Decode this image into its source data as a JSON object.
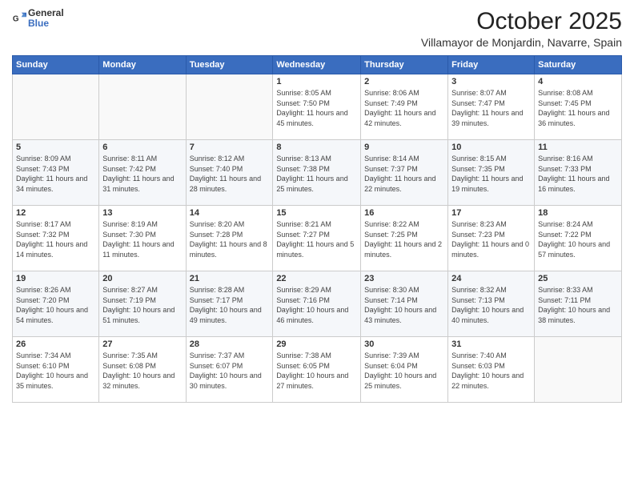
{
  "logo": {
    "general": "General",
    "blue": "Blue"
  },
  "header": {
    "month": "October 2025",
    "location": "Villamayor de Monjardin, Navarre, Spain"
  },
  "weekdays": [
    "Sunday",
    "Monday",
    "Tuesday",
    "Wednesday",
    "Thursday",
    "Friday",
    "Saturday"
  ],
  "weeks": [
    [
      {
        "day": "",
        "sunrise": "",
        "sunset": "",
        "daylight": ""
      },
      {
        "day": "",
        "sunrise": "",
        "sunset": "",
        "daylight": ""
      },
      {
        "day": "",
        "sunrise": "",
        "sunset": "",
        "daylight": ""
      },
      {
        "day": "1",
        "sunrise": "Sunrise: 8:05 AM",
        "sunset": "Sunset: 7:50 PM",
        "daylight": "Daylight: 11 hours and 45 minutes."
      },
      {
        "day": "2",
        "sunrise": "Sunrise: 8:06 AM",
        "sunset": "Sunset: 7:49 PM",
        "daylight": "Daylight: 11 hours and 42 minutes."
      },
      {
        "day": "3",
        "sunrise": "Sunrise: 8:07 AM",
        "sunset": "Sunset: 7:47 PM",
        "daylight": "Daylight: 11 hours and 39 minutes."
      },
      {
        "day": "4",
        "sunrise": "Sunrise: 8:08 AM",
        "sunset": "Sunset: 7:45 PM",
        "daylight": "Daylight: 11 hours and 36 minutes."
      }
    ],
    [
      {
        "day": "5",
        "sunrise": "Sunrise: 8:09 AM",
        "sunset": "Sunset: 7:43 PM",
        "daylight": "Daylight: 11 hours and 34 minutes."
      },
      {
        "day": "6",
        "sunrise": "Sunrise: 8:11 AM",
        "sunset": "Sunset: 7:42 PM",
        "daylight": "Daylight: 11 hours and 31 minutes."
      },
      {
        "day": "7",
        "sunrise": "Sunrise: 8:12 AM",
        "sunset": "Sunset: 7:40 PM",
        "daylight": "Daylight: 11 hours and 28 minutes."
      },
      {
        "day": "8",
        "sunrise": "Sunrise: 8:13 AM",
        "sunset": "Sunset: 7:38 PM",
        "daylight": "Daylight: 11 hours and 25 minutes."
      },
      {
        "day": "9",
        "sunrise": "Sunrise: 8:14 AM",
        "sunset": "Sunset: 7:37 PM",
        "daylight": "Daylight: 11 hours and 22 minutes."
      },
      {
        "day": "10",
        "sunrise": "Sunrise: 8:15 AM",
        "sunset": "Sunset: 7:35 PM",
        "daylight": "Daylight: 11 hours and 19 minutes."
      },
      {
        "day": "11",
        "sunrise": "Sunrise: 8:16 AM",
        "sunset": "Sunset: 7:33 PM",
        "daylight": "Daylight: 11 hours and 16 minutes."
      }
    ],
    [
      {
        "day": "12",
        "sunrise": "Sunrise: 8:17 AM",
        "sunset": "Sunset: 7:32 PM",
        "daylight": "Daylight: 11 hours and 14 minutes."
      },
      {
        "day": "13",
        "sunrise": "Sunrise: 8:19 AM",
        "sunset": "Sunset: 7:30 PM",
        "daylight": "Daylight: 11 hours and 11 minutes."
      },
      {
        "day": "14",
        "sunrise": "Sunrise: 8:20 AM",
        "sunset": "Sunset: 7:28 PM",
        "daylight": "Daylight: 11 hours and 8 minutes."
      },
      {
        "day": "15",
        "sunrise": "Sunrise: 8:21 AM",
        "sunset": "Sunset: 7:27 PM",
        "daylight": "Daylight: 11 hours and 5 minutes."
      },
      {
        "day": "16",
        "sunrise": "Sunrise: 8:22 AM",
        "sunset": "Sunset: 7:25 PM",
        "daylight": "Daylight: 11 hours and 2 minutes."
      },
      {
        "day": "17",
        "sunrise": "Sunrise: 8:23 AM",
        "sunset": "Sunset: 7:23 PM",
        "daylight": "Daylight: 11 hours and 0 minutes."
      },
      {
        "day": "18",
        "sunrise": "Sunrise: 8:24 AM",
        "sunset": "Sunset: 7:22 PM",
        "daylight": "Daylight: 10 hours and 57 minutes."
      }
    ],
    [
      {
        "day": "19",
        "sunrise": "Sunrise: 8:26 AM",
        "sunset": "Sunset: 7:20 PM",
        "daylight": "Daylight: 10 hours and 54 minutes."
      },
      {
        "day": "20",
        "sunrise": "Sunrise: 8:27 AM",
        "sunset": "Sunset: 7:19 PM",
        "daylight": "Daylight: 10 hours and 51 minutes."
      },
      {
        "day": "21",
        "sunrise": "Sunrise: 8:28 AM",
        "sunset": "Sunset: 7:17 PM",
        "daylight": "Daylight: 10 hours and 49 minutes."
      },
      {
        "day": "22",
        "sunrise": "Sunrise: 8:29 AM",
        "sunset": "Sunset: 7:16 PM",
        "daylight": "Daylight: 10 hours and 46 minutes."
      },
      {
        "day": "23",
        "sunrise": "Sunrise: 8:30 AM",
        "sunset": "Sunset: 7:14 PM",
        "daylight": "Daylight: 10 hours and 43 minutes."
      },
      {
        "day": "24",
        "sunrise": "Sunrise: 8:32 AM",
        "sunset": "Sunset: 7:13 PM",
        "daylight": "Daylight: 10 hours and 40 minutes."
      },
      {
        "day": "25",
        "sunrise": "Sunrise: 8:33 AM",
        "sunset": "Sunset: 7:11 PM",
        "daylight": "Daylight: 10 hours and 38 minutes."
      }
    ],
    [
      {
        "day": "26",
        "sunrise": "Sunrise: 7:34 AM",
        "sunset": "Sunset: 6:10 PM",
        "daylight": "Daylight: 10 hours and 35 minutes."
      },
      {
        "day": "27",
        "sunrise": "Sunrise: 7:35 AM",
        "sunset": "Sunset: 6:08 PM",
        "daylight": "Daylight: 10 hours and 32 minutes."
      },
      {
        "day": "28",
        "sunrise": "Sunrise: 7:37 AM",
        "sunset": "Sunset: 6:07 PM",
        "daylight": "Daylight: 10 hours and 30 minutes."
      },
      {
        "day": "29",
        "sunrise": "Sunrise: 7:38 AM",
        "sunset": "Sunset: 6:05 PM",
        "daylight": "Daylight: 10 hours and 27 minutes."
      },
      {
        "day": "30",
        "sunrise": "Sunrise: 7:39 AM",
        "sunset": "Sunset: 6:04 PM",
        "daylight": "Daylight: 10 hours and 25 minutes."
      },
      {
        "day": "31",
        "sunrise": "Sunrise: 7:40 AM",
        "sunset": "Sunset: 6:03 PM",
        "daylight": "Daylight: 10 hours and 22 minutes."
      },
      {
        "day": "",
        "sunrise": "",
        "sunset": "",
        "daylight": ""
      }
    ]
  ]
}
